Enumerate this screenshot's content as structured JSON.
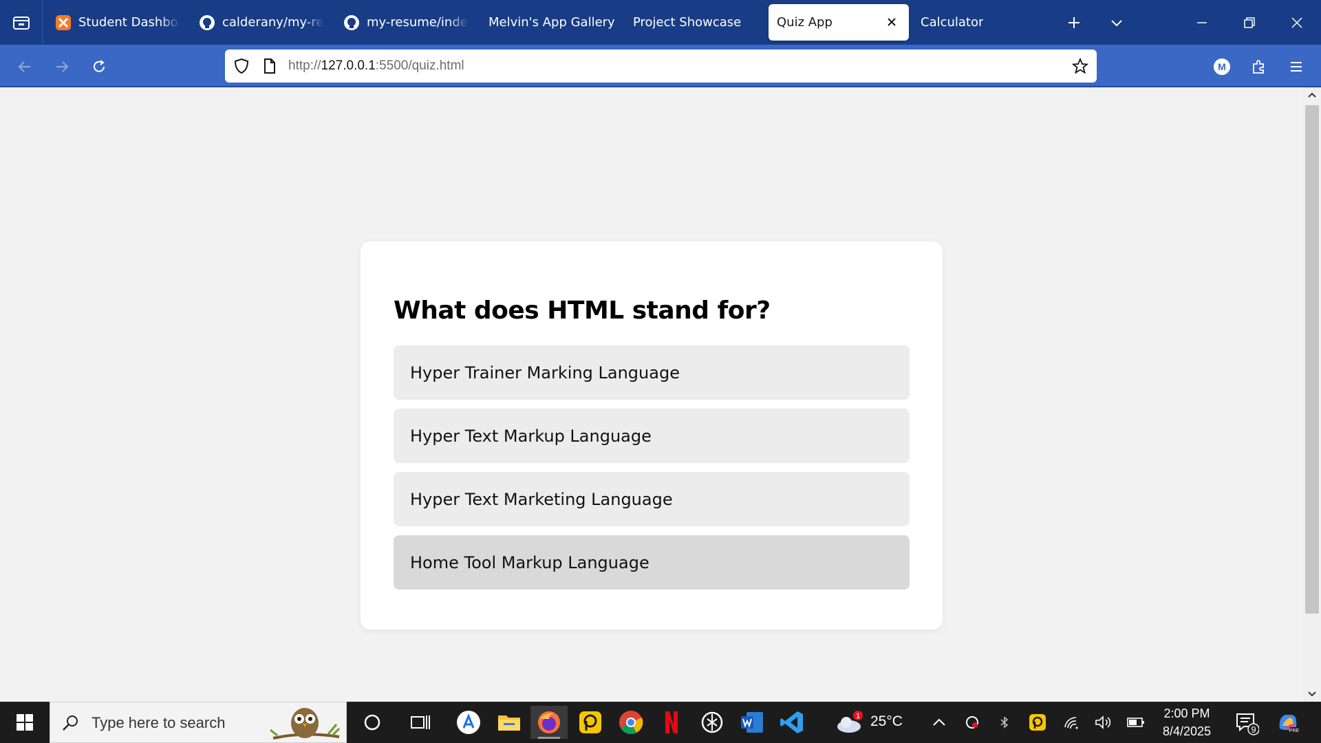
{
  "browser": {
    "tabs": [
      {
        "title": "Student Dashboard",
        "icon": "xampp-icon"
      },
      {
        "title": "calderany/my-resume",
        "icon": "github-icon"
      },
      {
        "title": "my-resume/index.html",
        "icon": "github-icon"
      },
      {
        "title": "Melvin's App Gallery",
        "icon": ""
      },
      {
        "title": "Project Showcase",
        "icon": ""
      },
      {
        "title": "Quiz App",
        "icon": "",
        "active": true
      },
      {
        "title": "Calculator",
        "icon": ""
      }
    ],
    "url_prefix": "http://",
    "url_host": "127.0.0.1",
    "url_rest": ":5500/quiz.html",
    "account_initial": "M"
  },
  "quiz": {
    "question": "What does HTML stand for?",
    "answers": [
      "Hyper Trainer Marking Language",
      "Hyper Text Markup Language",
      "Hyper Text Marketing Language",
      "Home Tool Markup Language"
    ],
    "hovered_answer_index": 3
  },
  "taskbar": {
    "search_placeholder": "Type here to search",
    "weather_temp": "25°C",
    "weather_badge": "1",
    "time": "2:00 PM",
    "date": "8/4/2025",
    "notification_count": "9",
    "apps": [
      "cortana-icon",
      "task-view-icon",
      "app-store-icon",
      "file-explorer-icon",
      "firefox-icon",
      "remote-app-icon",
      "chrome-icon",
      "netflix-icon",
      "chatgpt-icon",
      "word-icon",
      "vscode-icon"
    ]
  },
  "colors": {
    "tabbar": "#183d86",
    "navbar": "#3a68c4",
    "card": "#ffffff",
    "answer_bg": "#ececec",
    "answer_hover_bg": "#d9d9d9"
  }
}
